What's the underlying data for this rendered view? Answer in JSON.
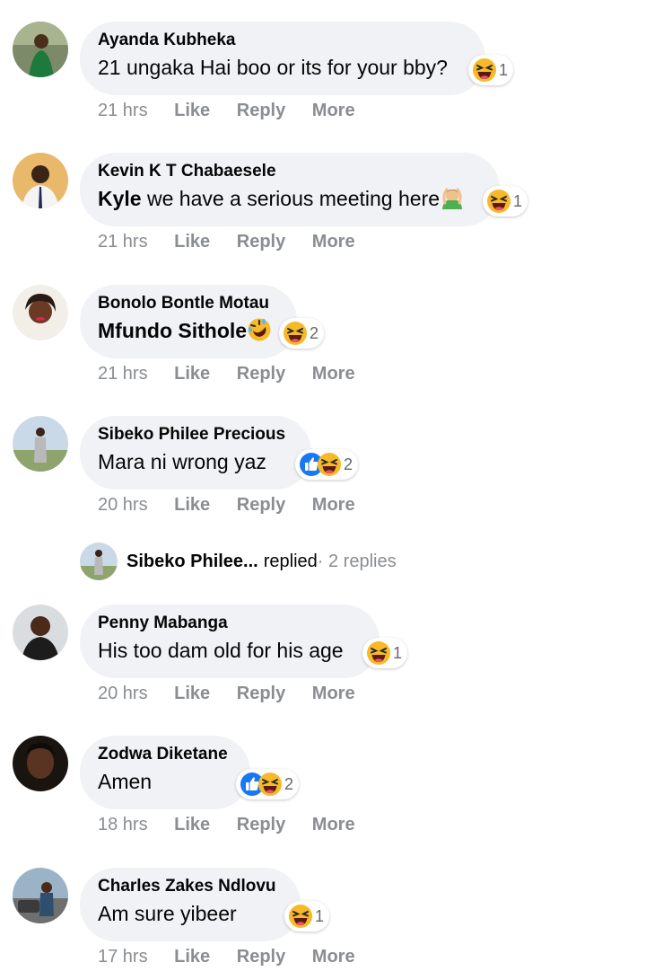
{
  "actions": {
    "like": "Like",
    "reply": "Reply",
    "more": "More"
  },
  "comments": [
    {
      "name": "Ayanda Kubheka",
      "text": "21 ungaka Hai boo or its for your bby?",
      "time": "21 hrs",
      "reaction_count": "1",
      "reactions": [
        "haha"
      ]
    },
    {
      "name": "Kevin K T Chabaesele",
      "mention": "Kyle",
      "text": " we have a serious meeting here",
      "trailing_emoji": "person-gesturing-ok-emoji",
      "time": "21 hrs",
      "reaction_count": "1",
      "reactions": [
        "haha"
      ]
    },
    {
      "name": "Bonolo Bontle Motau",
      "mention": "Mfundo Sithole",
      "trailing_emoji": "rolling-on-floor-laughing-emoji",
      "time": "21 hrs",
      "reaction_count": "2",
      "reactions": [
        "haha"
      ]
    },
    {
      "name": "Sibeko Philee Precious",
      "text": "Mara ni wrong yaz",
      "time": "20 hrs",
      "reaction_count": "2",
      "reactions": [
        "like",
        "haha"
      ]
    },
    {
      "name": "Penny Mabanga",
      "text": "His too dam old for his age",
      "time": "20 hrs",
      "reaction_count": "1",
      "reactions": [
        "haha"
      ]
    },
    {
      "name": "Zodwa Diketane",
      "text": "Amen",
      "time": "18 hrs",
      "reaction_count": "2",
      "reactions": [
        "like",
        "haha"
      ]
    },
    {
      "name": "Charles Zakes Ndlovu",
      "text": "Am sure yibeer",
      "time": "17 hrs",
      "reaction_count": "1",
      "reactions": [
        "haha"
      ]
    }
  ],
  "reply_summary": {
    "name": "Sibeko Philee...",
    "verb": "replied",
    "count": " · 2 replies"
  },
  "colors": {
    "bubble": "#f0f2f5",
    "action_text": "#8a8d91",
    "like_blue": "#1877f2",
    "haha_yellow": "#f7b928"
  }
}
